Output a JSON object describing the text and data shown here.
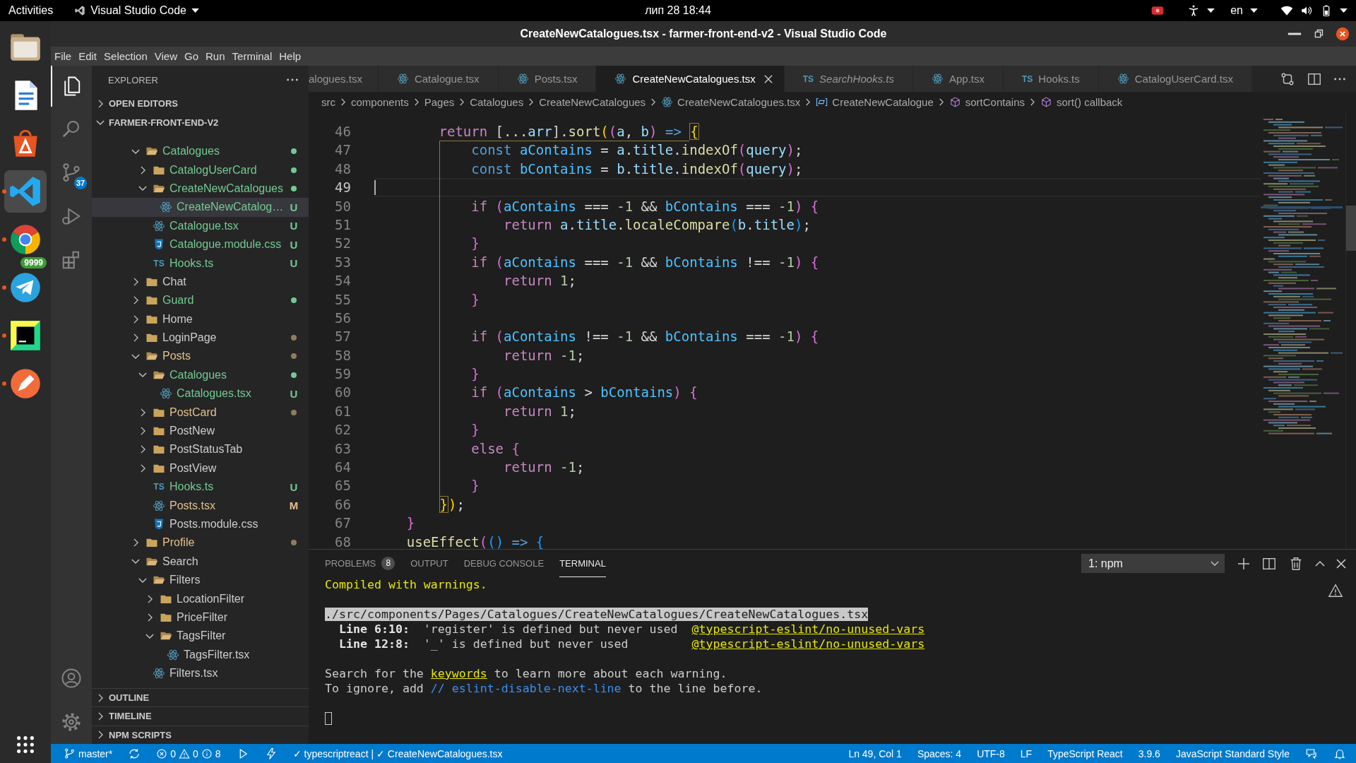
{
  "top_bar": {
    "activities": "Activities",
    "app_menu": "Visual Studio Code",
    "clock": "лип 28  18:44",
    "keyboard_layout": "en"
  },
  "dock": {
    "apps": [
      {
        "kind": "files",
        "running": false,
        "active": false
      },
      {
        "kind": "writer",
        "running": false,
        "active": false
      },
      {
        "kind": "software",
        "running": false,
        "active": false
      },
      {
        "kind": "vscode",
        "running": true,
        "active": true
      },
      {
        "kind": "chrome",
        "running": true,
        "active": false
      },
      {
        "kind": "telegram",
        "running": true,
        "active": false,
        "badge": "9999"
      },
      {
        "kind": "pycharm",
        "running": true,
        "active": false
      },
      {
        "kind": "pen",
        "running": true,
        "active": false
      }
    ]
  },
  "window": {
    "title": "CreateNewCatalogues.tsx - farmer-front-end-v2 - Visual Studio Code"
  },
  "menu": [
    "File",
    "Edit",
    "Selection",
    "View",
    "Go",
    "Run",
    "Terminal",
    "Help"
  ],
  "activity_bar": {
    "items": [
      {
        "kind": "explorer",
        "selected": true
      },
      {
        "kind": "search",
        "selected": false
      },
      {
        "kind": "source_control",
        "selected": false,
        "badge": "37"
      },
      {
        "kind": "run",
        "selected": false
      },
      {
        "kind": "extensions",
        "selected": false
      }
    ],
    "bottom": [
      {
        "kind": "account"
      },
      {
        "kind": "settings"
      }
    ]
  },
  "sidebar": {
    "title": "EXPLORER",
    "sections": [
      {
        "label": "OPEN EDITORS",
        "expanded": false
      },
      {
        "label": "FARMER-FRONT-END-V2",
        "expanded": true
      }
    ],
    "tree": [
      {
        "label": "Catalogues",
        "kind": "folder",
        "expanded": true,
        "selected": false,
        "color": "#73c991",
        "dot": true,
        "dot_dim": false,
        "children": [
          {
            "label": "CatalogUserCard",
            "kind": "folder",
            "expanded": false,
            "selected": false,
            "color": "#73c991",
            "dot": true,
            "dot_dim": false
          },
          {
            "label": "CreateNewCatalogues",
            "kind": "folder",
            "expanded": true,
            "selected": false,
            "color": "#73c991",
            "dot": true,
            "dot_dim": false,
            "children": [
              {
                "label": "CreateNewCatalog…",
                "kind": "react",
                "selected": true,
                "color": "#73c991",
                "badge": "U"
              }
            ]
          },
          {
            "label": "Catalogue.tsx",
            "kind": "react",
            "selected": false,
            "color": "#73c991",
            "badge": "U"
          },
          {
            "label": "Catalogue.module.css",
            "kind": "css",
            "selected": false,
            "color": "#73c991",
            "badge": "U"
          },
          {
            "label": "Hooks.ts",
            "kind": "ts",
            "icon_label": "TS",
            "selected": false,
            "color": "#73c991",
            "badge": "U"
          }
        ]
      },
      {
        "label": "Chat",
        "kind": "folder",
        "expanded": false,
        "selected": false,
        "color": "#cccccc"
      },
      {
        "label": "Guard",
        "kind": "folder",
        "expanded": false,
        "selected": false,
        "color": "#73c991",
        "dot": true,
        "dot_dim": false
      },
      {
        "label": "Home",
        "kind": "folder",
        "expanded": false,
        "selected": false,
        "color": "#cccccc"
      },
      {
        "label": "LoginPage",
        "kind": "folder",
        "expanded": false,
        "selected": false,
        "color": "#cccccc",
        "dot": true,
        "dot_dim": true
      },
      {
        "label": "Posts",
        "kind": "folder",
        "expanded": true,
        "selected": false,
        "color": "#e2c08d",
        "dot": true,
        "dot_dim": true,
        "children": [
          {
            "label": "Catalogues",
            "kind": "folder",
            "expanded": true,
            "selected": false,
            "color": "#73c991",
            "dot": true,
            "dot_dim": false,
            "children": [
              {
                "label": "Catalogues.tsx",
                "kind": "react",
                "selected": false,
                "color": "#73c991",
                "badge": "U"
              }
            ]
          },
          {
            "label": "PostCard",
            "kind": "folder",
            "expanded": false,
            "selected": false,
            "color": "#e2c08d",
            "dot": true,
            "dot_dim": true
          },
          {
            "label": "PostNew",
            "kind": "folder",
            "expanded": false,
            "selected": false,
            "color": "#cccccc"
          },
          {
            "label": "PostStatusTab",
            "kind": "folder",
            "expanded": false,
            "selected": false,
            "color": "#cccccc"
          },
          {
            "label": "PostView",
            "kind": "folder",
            "expanded": false,
            "selected": false,
            "color": "#cccccc"
          },
          {
            "label": "Hooks.ts",
            "kind": "ts",
            "icon_label": "TS",
            "selected": false,
            "color": "#73c991",
            "badge": "U"
          },
          {
            "label": "Posts.tsx",
            "kind": "react",
            "selected": false,
            "color": "#e2c08d",
            "badge": "M"
          },
          {
            "label": "Posts.module.css",
            "kind": "css",
            "selected": false,
            "color": "#cccccc"
          }
        ]
      },
      {
        "label": "Profile",
        "kind": "folder",
        "expanded": false,
        "selected": false,
        "color": "#e2c08d",
        "dot": true,
        "dot_dim": true
      },
      {
        "label": "Search",
        "kind": "folder",
        "expanded": true,
        "selected": false,
        "color": "#cccccc",
        "children": [
          {
            "label": "Filters",
            "kind": "folder",
            "expanded": true,
            "selected": false,
            "color": "#cccccc",
            "children": [
              {
                "label": "LocationFilter",
                "kind": "folder",
                "expanded": false,
                "selected": false,
                "color": "#cccccc"
              },
              {
                "label": "PriceFilter",
                "kind": "folder",
                "expanded": false,
                "selected": false,
                "color": "#cccccc"
              },
              {
                "label": "TagsFilter",
                "kind": "folder",
                "expanded": true,
                "selected": false,
                "color": "#cccccc",
                "children": [
                  {
                    "label": "TagsFilter.tsx",
                    "kind": "react",
                    "selected": false,
                    "color": "#cccccc"
                  }
                ]
              }
            ]
          },
          {
            "label": "Filters.tsx",
            "kind": "react",
            "selected": false,
            "color": "#cccccc"
          }
        ]
      }
    ],
    "bottom_sections": [
      {
        "label": "OUTLINE",
        "expanded": false
      },
      {
        "label": "TIMELINE",
        "expanded": false
      },
      {
        "label": "NPM SCRIPTS",
        "expanded": false
      }
    ]
  },
  "tabs": [
    {
      "label": "alogues.tsx",
      "selected": false
    },
    {
      "label": "Catalogue.tsx",
      "kind": "react",
      "selected": false
    },
    {
      "label": "Posts.tsx",
      "kind": "react",
      "selected": false
    },
    {
      "label": "CreateNewCatalogues.tsx",
      "kind": "react",
      "selected": true
    },
    {
      "label": "SearchHooks.ts",
      "kind": "ts",
      "icon_label": "TS",
      "italic": true,
      "selected": false
    },
    {
      "label": "App.tsx",
      "kind": "react",
      "selected": false
    },
    {
      "label": "Hooks.ts",
      "kind": "ts",
      "icon_label": "TS",
      "selected": false
    },
    {
      "label": "CatalogUserCard.tsx",
      "kind": "react",
      "selected": false
    }
  ],
  "breadcrumbs": [
    {
      "label": "src",
      "kind": "folder"
    },
    {
      "label": "components",
      "kind": "folder"
    },
    {
      "label": "Pages",
      "kind": "folder"
    },
    {
      "label": "Catalogues",
      "kind": "folder"
    },
    {
      "label": "CreateNewCatalogues",
      "kind": "folder"
    },
    {
      "label": "CreateNewCatalogues.tsx",
      "kind": "react"
    },
    {
      "label": "CreateNewCatalogue",
      "kind": "variable"
    },
    {
      "label": "sortContains",
      "kind": "method"
    },
    {
      "label": "sort() callback",
      "kind": "method"
    }
  ],
  "code": {
    "lines": [
      {
        "number": "46",
        "current": false,
        "tokens": [
          {
            "kind": "keyword",
            "text": "        return"
          },
          {
            "kind": "operator",
            "text": " [..."
          },
          {
            "kind": "variable",
            "text": "arr"
          },
          {
            "kind": "operator",
            "text": "]."
          },
          {
            "kind": "function",
            "text": "sort"
          },
          {
            "kind": "bracket_gold",
            "text": "("
          },
          {
            "kind": "bracket_pink",
            "text": "("
          },
          {
            "kind": "variable",
            "text": "a"
          },
          {
            "kind": "operator",
            "text": ", "
          },
          {
            "kind": "variable",
            "text": "b"
          },
          {
            "kind": "bracket_pink",
            "text": ")"
          },
          {
            "kind": "storage",
            "text": " =>"
          },
          {
            "kind": "bracket_match",
            "text": " {"
          }
        ]
      },
      {
        "number": "47",
        "current": false,
        "tokens": [
          {
            "kind": "storage",
            "text": "            const"
          },
          {
            "kind": "constant",
            "text": " aContains"
          },
          {
            "kind": "operator",
            "text": " = "
          },
          {
            "kind": "variable",
            "text": "a"
          },
          {
            "kind": "operator",
            "text": "."
          },
          {
            "kind": "variable",
            "text": "title"
          },
          {
            "kind": "operator",
            "text": "."
          },
          {
            "kind": "function",
            "text": "indexOf"
          },
          {
            "kind": "bracket_pink",
            "text": "("
          },
          {
            "kind": "variable",
            "text": "query"
          },
          {
            "kind": "bracket_pink",
            "text": ")"
          },
          {
            "kind": "operator",
            "text": ";"
          }
        ]
      },
      {
        "number": "48",
        "current": false,
        "tokens": [
          {
            "kind": "storage",
            "text": "            const"
          },
          {
            "kind": "constant",
            "text": " bContains"
          },
          {
            "kind": "operator",
            "text": " = "
          },
          {
            "kind": "variable",
            "text": "b"
          },
          {
            "kind": "operator",
            "text": "."
          },
          {
            "kind": "variable",
            "text": "title"
          },
          {
            "kind": "operator",
            "text": "."
          },
          {
            "kind": "function",
            "text": "indexOf"
          },
          {
            "kind": "bracket_pink",
            "text": "("
          },
          {
            "kind": "variable",
            "text": "query"
          },
          {
            "kind": "bracket_pink",
            "text": ")"
          },
          {
            "kind": "operator",
            "text": ";"
          }
        ]
      },
      {
        "number": "49",
        "current": true
      },
      {
        "number": "50",
        "current": false,
        "tokens": [
          {
            "kind": "keyword",
            "text": "            if"
          },
          {
            "kind": "bracket_pink",
            "text": " ("
          },
          {
            "kind": "constant",
            "text": "aContains"
          },
          {
            "kind": "operator",
            "text": " === "
          },
          {
            "kind": "number",
            "text": "-1"
          },
          {
            "kind": "operator",
            "text": " && "
          },
          {
            "kind": "constant",
            "text": "bContains"
          },
          {
            "kind": "operator",
            "text": " === "
          },
          {
            "kind": "number",
            "text": "-1"
          },
          {
            "kind": "bracket_pink",
            "text": ")"
          },
          {
            "kind": "bracket_pink",
            "text": " {"
          }
        ]
      },
      {
        "number": "51",
        "current": false,
        "tokens": [
          {
            "kind": "keyword",
            "text": "                return"
          },
          {
            "kind": "variable",
            "text": " a"
          },
          {
            "kind": "operator",
            "text": "."
          },
          {
            "kind": "variable",
            "text": "title"
          },
          {
            "kind": "operator",
            "text": "."
          },
          {
            "kind": "function",
            "text": "localeCompare"
          },
          {
            "kind": "bracket_blue",
            "text": "("
          },
          {
            "kind": "variable",
            "text": "b"
          },
          {
            "kind": "operator",
            "text": "."
          },
          {
            "kind": "variable",
            "text": "title"
          },
          {
            "kind": "bracket_blue",
            "text": ")"
          },
          {
            "kind": "operator",
            "text": ";"
          }
        ]
      },
      {
        "number": "52",
        "current": false,
        "tokens": [
          {
            "kind": "bracket_pink",
            "text": "            }"
          }
        ]
      },
      {
        "number": "53",
        "current": false,
        "tokens": [
          {
            "kind": "keyword",
            "text": "            if"
          },
          {
            "kind": "bracket_pink",
            "text": " ("
          },
          {
            "kind": "constant",
            "text": "aContains"
          },
          {
            "kind": "operator",
            "text": " === "
          },
          {
            "kind": "number",
            "text": "-1"
          },
          {
            "kind": "operator",
            "text": " && "
          },
          {
            "kind": "constant",
            "text": "bContains"
          },
          {
            "kind": "operator",
            "text": " !== "
          },
          {
            "kind": "number",
            "text": "-1"
          },
          {
            "kind": "bracket_pink",
            "text": ")"
          },
          {
            "kind": "bracket_pink",
            "text": " {"
          }
        ]
      },
      {
        "number": "54",
        "current": false,
        "tokens": [
          {
            "kind": "keyword",
            "text": "                return"
          },
          {
            "kind": "number",
            "text": " 1"
          },
          {
            "kind": "operator",
            "text": ";"
          }
        ]
      },
      {
        "number": "55",
        "current": false,
        "tokens": [
          {
            "kind": "bracket_pink",
            "text": "            }"
          }
        ]
      },
      {
        "number": "56",
        "current": false
      },
      {
        "number": "57",
        "current": false,
        "tokens": [
          {
            "kind": "keyword",
            "text": "            if"
          },
          {
            "kind": "bracket_pink",
            "text": " ("
          },
          {
            "kind": "constant",
            "text": "aContains"
          },
          {
            "kind": "operator",
            "text": " !== "
          },
          {
            "kind": "number",
            "text": "-1"
          },
          {
            "kind": "operator",
            "text": " && "
          },
          {
            "kind": "constant",
            "text": "bContains"
          },
          {
            "kind": "operator",
            "text": " === "
          },
          {
            "kind": "number",
            "text": "-1"
          },
          {
            "kind": "bracket_pink",
            "text": ")"
          },
          {
            "kind": "bracket_pink",
            "text": " {"
          }
        ]
      },
      {
        "number": "58",
        "current": false,
        "tokens": [
          {
            "kind": "keyword",
            "text": "                return"
          },
          {
            "kind": "number",
            "text": " -1"
          },
          {
            "kind": "operator",
            "text": ";"
          }
        ]
      },
      {
        "number": "59",
        "current": false,
        "tokens": [
          {
            "kind": "bracket_pink",
            "text": "            }"
          }
        ]
      },
      {
        "number": "60",
        "current": false,
        "tokens": [
          {
            "kind": "keyword",
            "text": "            if"
          },
          {
            "kind": "bracket_pink",
            "text": " ("
          },
          {
            "kind": "constant",
            "text": "aContains"
          },
          {
            "kind": "operator",
            "text": " > "
          },
          {
            "kind": "constant",
            "text": "bContains"
          },
          {
            "kind": "bracket_pink",
            "text": ")"
          },
          {
            "kind": "bracket_pink",
            "text": " {"
          }
        ]
      },
      {
        "number": "61",
        "current": false,
        "tokens": [
          {
            "kind": "keyword",
            "text": "                return"
          },
          {
            "kind": "number",
            "text": " 1"
          },
          {
            "kind": "operator",
            "text": ";"
          }
        ]
      },
      {
        "number": "62",
        "current": false,
        "tokens": [
          {
            "kind": "bracket_pink",
            "text": "            }"
          }
        ]
      },
      {
        "number": "63",
        "current": false,
        "tokens": [
          {
            "kind": "keyword",
            "text": "            else"
          },
          {
            "kind": "bracket_pink",
            "text": " {"
          }
        ]
      },
      {
        "number": "64",
        "current": false,
        "tokens": [
          {
            "kind": "keyword",
            "text": "                return"
          },
          {
            "kind": "number",
            "text": " -1"
          },
          {
            "kind": "operator",
            "text": ";"
          }
        ]
      },
      {
        "number": "65",
        "current": false,
        "tokens": [
          {
            "kind": "bracket_pink",
            "text": "            }"
          }
        ]
      },
      {
        "number": "66",
        "current": false,
        "tokens": [
          {
            "kind": "bracket_match",
            "text": "        }"
          },
          {
            "kind": "bracket_gold",
            "text": ")"
          },
          {
            "kind": "operator",
            "text": ";"
          }
        ]
      },
      {
        "number": "67",
        "current": false,
        "tokens": [
          {
            "kind": "bracket_pink",
            "text": "    }"
          }
        ]
      },
      {
        "number": "68",
        "current": false,
        "tokens": [
          {
            "kind": "function",
            "text": "    useEffect"
          },
          {
            "kind": "bracket_pink",
            "text": "("
          },
          {
            "kind": "bracket_blue",
            "text": "("
          },
          {
            "kind": "bracket_blue",
            "text": ")"
          },
          {
            "kind": "storage",
            "text": " =>"
          },
          {
            "kind": "bracket_blue",
            "text": " {"
          }
        ]
      }
    ]
  },
  "panel": {
    "tabs": [
      {
        "label": "PROBLEMS",
        "badge": "8",
        "selected": false
      },
      {
        "label": "OUTPUT",
        "selected": false
      },
      {
        "label": "DEBUG CONSOLE",
        "selected": false
      },
      {
        "label": "TERMINAL",
        "selected": true
      }
    ],
    "terminal_select": "1: npm",
    "terminal": {
      "blocks": [
        {
          "lines": [
            {
              "segments": [
                {
                  "kind": "warning",
                  "text": "Compiled with warnings."
                }
              ]
            }
          ]
        },
        {
          "lines": [
            {
              "segments": [
                {
                  "kind": "selected",
                  "text": "./src/components/Pages/Catalogues/CreateNewCatalogues/CreateNewCatalogues.tsx"
                }
              ]
            },
            {
              "segments": [
                {
                  "kind": "bold",
                  "text": "  Line 6:10:"
                },
                {
                  "kind": "plain",
                  "text": "  'register' is defined but never used  "
                },
                {
                  "kind": "link",
                  "text": "@typescript-eslint/no-unused-vars"
                }
              ]
            },
            {
              "segments": [
                {
                  "kind": "bold",
                  "text": "  Line 12:8:"
                },
                {
                  "kind": "plain",
                  "text": "  '_' is defined but never used         "
                },
                {
                  "kind": "link",
                  "text": "@typescript-eslint/no-unused-vars"
                }
              ]
            }
          ]
        },
        {
          "lines": [
            {
              "segments": [
                {
                  "kind": "plain",
                  "text": "Search for the "
                },
                {
                  "kind": "link",
                  "text": "keywords"
                },
                {
                  "kind": "plain",
                  "text": " to learn more about each warning."
                }
              ]
            },
            {
              "segments": [
                {
                  "kind": "plain",
                  "text": "To ignore, add "
                },
                {
                  "kind": "comment",
                  "text": "// eslint-disable-next-line"
                },
                {
                  "kind": "plain",
                  "text": " to the line before."
                }
              ]
            }
          ]
        }
      ],
      "cursor": true
    }
  },
  "status_bar": {
    "left": [
      {
        "kind": "branch",
        "text": "master*"
      },
      {
        "kind": "sync"
      },
      {
        "kind": "problems",
        "errors": "0",
        "warnings": "0",
        "infos": "8"
      },
      {
        "kind": "run"
      },
      {
        "kind": "bolt"
      },
      {
        "kind": "text",
        "text": "✓ typescriptreact | ✓ CreateNewCatalogues.tsx"
      }
    ],
    "right": [
      {
        "kind": "text",
        "text": "Ln 49, Col 1"
      },
      {
        "kind": "text",
        "text": "Spaces: 4"
      },
      {
        "kind": "text",
        "text": "UTF-8"
      },
      {
        "kind": "text",
        "text": "LF"
      },
      {
        "kind": "text",
        "text": "TypeScript React"
      },
      {
        "kind": "text",
        "text": "3.9.6"
      },
      {
        "kind": "text",
        "text": "JavaScript Standard Style"
      },
      {
        "kind": "feedback"
      },
      {
        "kind": "bell"
      }
    ]
  }
}
